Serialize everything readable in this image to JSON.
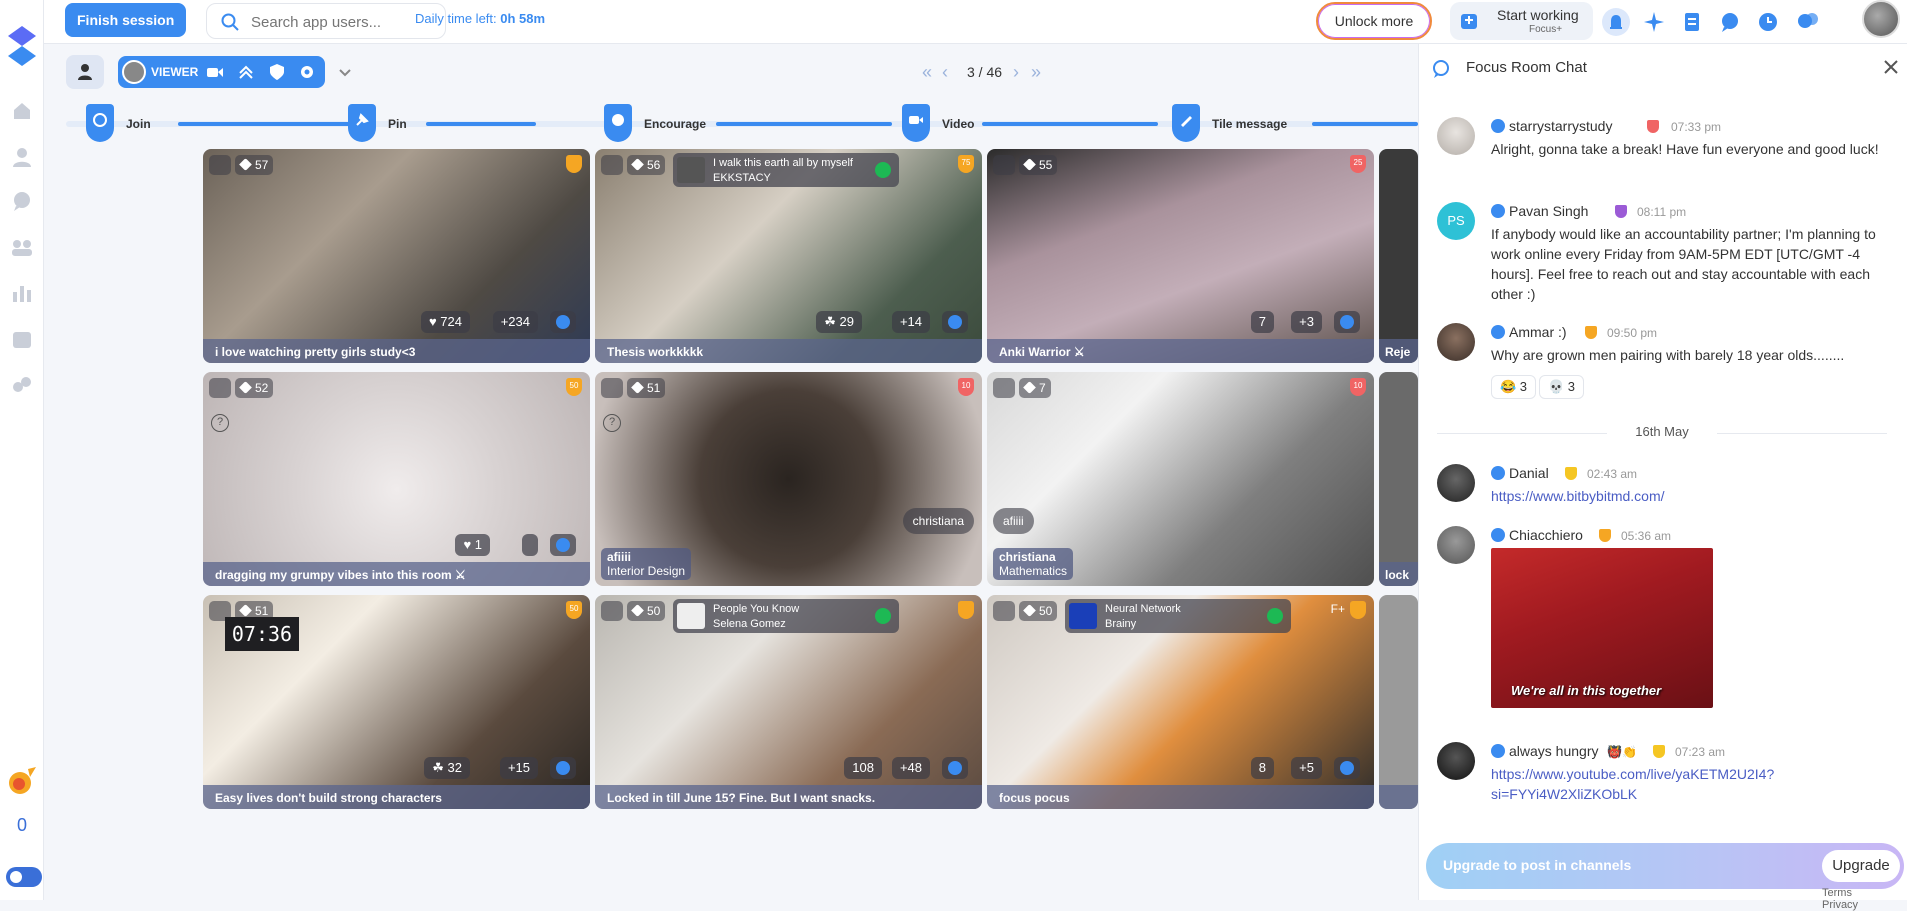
{
  "topbar": {
    "finish_label": "Finish session",
    "search_placeholder": "Search app users...",
    "daily_label": "Daily time left:",
    "daily_value": "0h 58m",
    "unlock_label": "Unlock more",
    "start_working_title": "Start working",
    "start_working_sub": "Focus+"
  },
  "rail": {
    "streak_count": "0"
  },
  "viewer": {
    "role_label": "VIEWER"
  },
  "pager": {
    "label": "3 / 46"
  },
  "steps": [
    "Join",
    "Pin",
    "Encourage",
    "Video",
    "Tile message"
  ],
  "tiles": [
    {
      "pins": "57",
      "caption": "i love watching pretty girls study<3",
      "stat1": "♥ 724",
      "stat2": "+234"
    },
    {
      "pins": "56",
      "caption": "Thesis workkkkk",
      "song1": "I walk this earth all by myself",
      "song2": "EKKSTACY",
      "level": "75",
      "stat1": "☘ 29",
      "stat2": "+14"
    },
    {
      "pins": "55",
      "caption": "Anki Warrior ⚔",
      "level": "25",
      "stat1": "7",
      "stat2": "+3"
    },
    {
      "pins": "52",
      "caption": "dragging my grumpy vibes into this room ⚔",
      "level": "50",
      "stat1": "♥ 1"
    },
    {
      "pins": "51",
      "user_name": "afiiii",
      "user_tag": "Interior Design",
      "chip": "christiana",
      "level": "10"
    },
    {
      "pins": "7",
      "user_name": "christiana",
      "user_tag": "Mathematics",
      "chip": "afiiii",
      "level": "10"
    },
    {
      "pins": "51",
      "caption": "Easy lives don't build strong characters",
      "timer": "07:36",
      "level": "50",
      "stat1": "☘ 32",
      "stat2": "+15"
    },
    {
      "pins": "50",
      "caption": "Locked in till June 15? Fine. But I want snacks.",
      "song1": "People You Know",
      "song2": "Selena Gomez",
      "stat1": "108",
      "stat2": "+48"
    },
    {
      "pins": "50",
      "caption": "focus pocus",
      "song1": "Neural Network",
      "song2": "Brainy",
      "level_text": "F+",
      "stat1": "8",
      "stat2": "+5"
    }
  ],
  "side_tiles": [
    "Reje",
    "lock",
    ""
  ],
  "chat": {
    "title": "Focus Room Chat",
    "messages": [
      {
        "name": "starrystarrystudy",
        "time": "07:33 pm",
        "body": "Alright, gonna take a break! Have fun everyone and good luck!"
      },
      {
        "name": "Pavan Singh",
        "initials": "PS",
        "time": "08:11 pm",
        "body": "If anybody would like an accountability partner; I'm planning to work online every Friday from 9AM-5PM EDT [UTC/GMT -4 hours]. Feel free to reach out and stay accountable with each other :)"
      },
      {
        "name": "Ammar :)",
        "time": "09:50 pm",
        "body": "Why are grown men pairing with barely 18 year olds........",
        "reactions": [
          "😂 3",
          "💀 3"
        ]
      },
      {
        "name": "Danial",
        "time": "02:43 am",
        "body": "https://www.bitbybitmd.com/"
      },
      {
        "name": "Chiacchiero",
        "time": "05:36 am",
        "gif_caption": "We're all in this together"
      },
      {
        "name": "always hungry",
        "emojis": "👹👏",
        "time": "07:23 am",
        "body": "https://www.youtube.com/live/yaKETM2U2I4?si=FYYi4W2XliZKObLK"
      }
    ],
    "date_sep": "16th May",
    "upgrade_placeholder": "Upgrade to post in channels",
    "upgrade_button": "Upgrade"
  },
  "footer": {
    "terms": "Terms",
    "privacy": "Privacy"
  },
  "colors": {
    "accent": "#3a8bf0",
    "link": "#4a5dc4"
  }
}
